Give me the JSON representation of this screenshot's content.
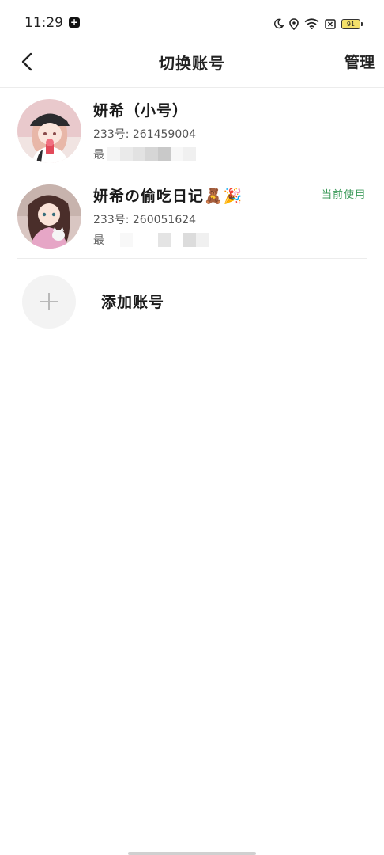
{
  "status_bar": {
    "time": "11:29",
    "battery": "91",
    "icons": [
      "plus-badge-icon",
      "moon-icon",
      "location-icon",
      "wifi-icon",
      "sim-x-icon",
      "battery-icon"
    ]
  },
  "header": {
    "title": "切换账号",
    "manage_label": "管理",
    "back_icon": "back-arrow-icon"
  },
  "accounts": [
    {
      "name": "妍希（小号）",
      "id_text": "233号: 261459004",
      "last_text": "最",
      "is_current": false,
      "current_label": ""
    },
    {
      "name": "妍希の偷吃日记🧸🎉",
      "id_text": "233号: 260051624",
      "last_text": "最",
      "is_current": true,
      "current_label": "当前使用"
    }
  ],
  "add_account": {
    "label": "添加账号",
    "icon": "plus-icon"
  },
  "colors": {
    "accent_green": "#3c9a5a",
    "divider": "#ececec",
    "add_circle": "#f3f3f3"
  }
}
